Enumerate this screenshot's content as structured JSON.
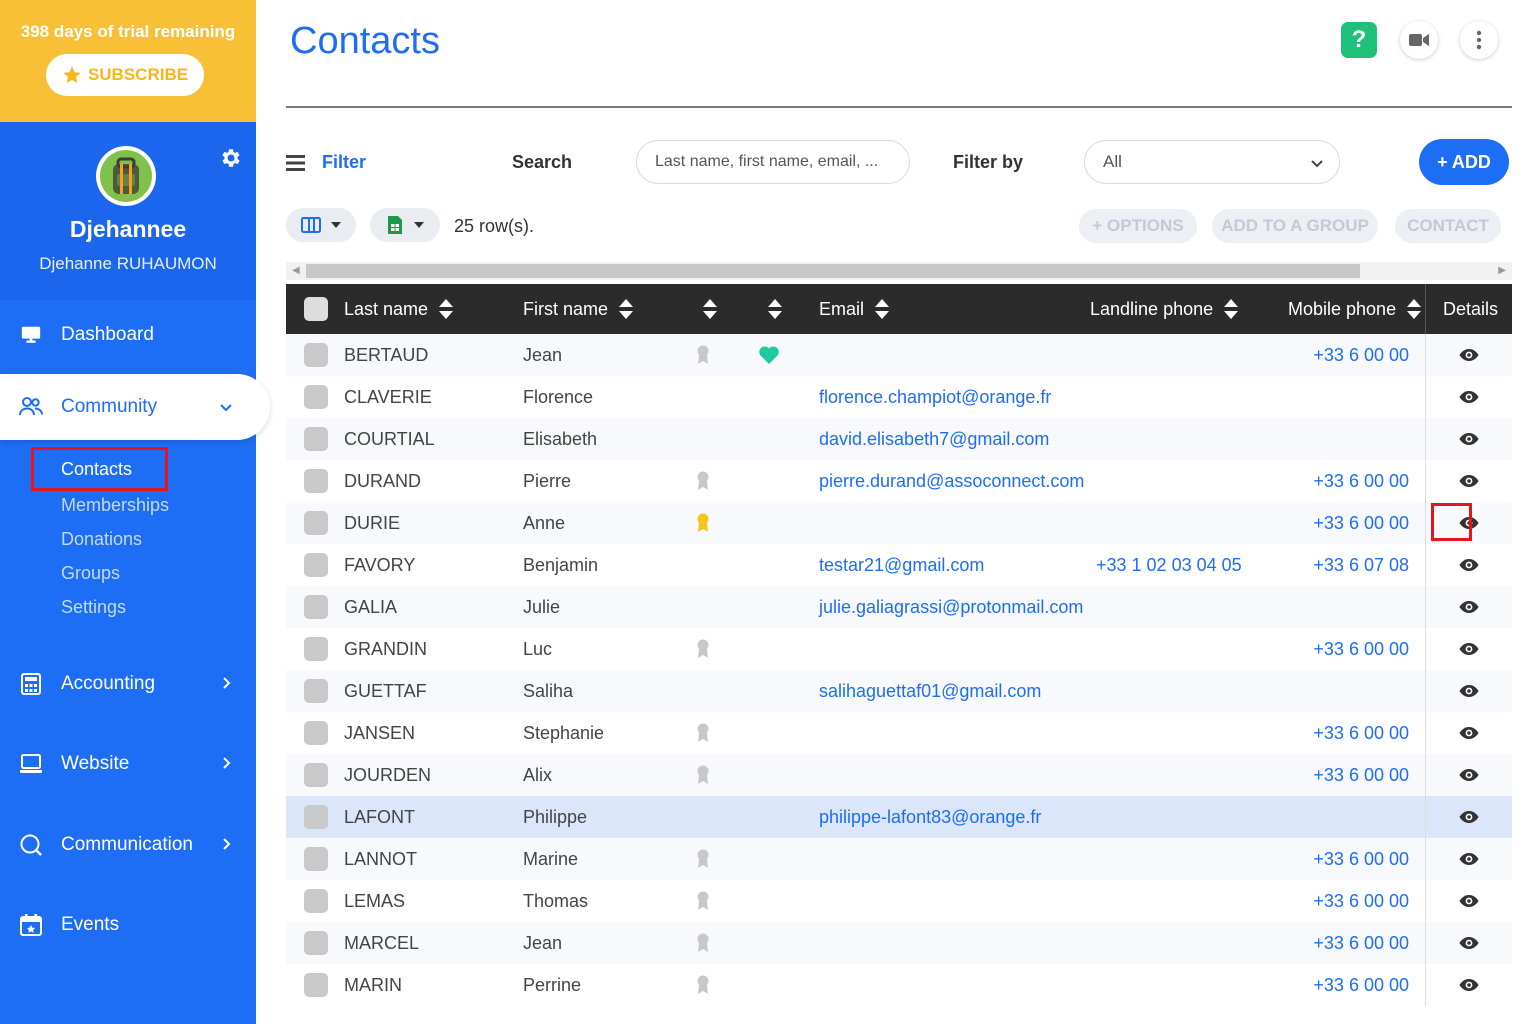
{
  "trial": {
    "text": "398 days of trial remaining",
    "subscribe_label": "SUBSCRIBE"
  },
  "profile": {
    "name": "Djehannee",
    "full_name": "Djehanne RUHAUMON"
  },
  "nav": {
    "dashboard": "Dashboard",
    "community": "Community",
    "community_sub": {
      "contacts": "Contacts",
      "memberships": "Memberships",
      "donations": "Donations",
      "groups": "Groups",
      "settings": "Settings"
    },
    "accounting": "Accounting",
    "website": "Website",
    "communication": "Communication",
    "events": "Events"
  },
  "header": {
    "title": "Contacts",
    "help_label": "?"
  },
  "toolbar": {
    "filter_label": "Filter",
    "search_label": "Search",
    "search_placeholder": "Last name, first name, email, ...",
    "filter_by_label": "Filter by",
    "filter_by_value": "All",
    "add_label": "+ ADD",
    "rows_count": "25 row(s).",
    "options_label": "+ OPTIONS",
    "add_to_group_label": "ADD TO A GROUP",
    "contact_label": "CONTACT"
  },
  "table": {
    "columns": {
      "last_name": "Last name",
      "first_name": "First name",
      "email": "Email",
      "landline": "Landline phone",
      "mobile": "Mobile phone",
      "details": "Details"
    },
    "rows": [
      {
        "last": "BERTAUD",
        "first": "Jean",
        "badge": "grey",
        "heart": true,
        "email": "",
        "landline": "",
        "mobile": "+33 6 00 00"
      },
      {
        "last": "CLAVERIE",
        "first": "Florence",
        "badge": "",
        "heart": false,
        "email": "florence.champiot@orange.fr",
        "landline": "",
        "mobile": ""
      },
      {
        "last": "COURTIAL",
        "first": "Elisabeth",
        "badge": "",
        "heart": false,
        "email": "david.elisabeth7@gmail.com",
        "landline": "",
        "mobile": ""
      },
      {
        "last": "DURAND",
        "first": "Pierre",
        "badge": "grey",
        "heart": false,
        "email": "pierre.durand@assoconnect.com",
        "landline": "",
        "mobile": "+33 6 00 00"
      },
      {
        "last": "DURIE",
        "first": "Anne",
        "badge": "gold",
        "heart": false,
        "email": "",
        "landline": "",
        "mobile": "+33 6 00 00"
      },
      {
        "last": "FAVORY",
        "first": "Benjamin",
        "badge": "",
        "heart": false,
        "email": "testar21@gmail.com",
        "landline": "+33 1 02 03 04 05",
        "mobile": "+33 6 07 08"
      },
      {
        "last": "GALIA",
        "first": "Julie",
        "badge": "",
        "heart": false,
        "email": "julie.galiagrassi@protonmail.com",
        "landline": "",
        "mobile": ""
      },
      {
        "last": "GRANDIN",
        "first": "Luc",
        "badge": "grey",
        "heart": false,
        "email": "",
        "landline": "",
        "mobile": "+33 6 00 00"
      },
      {
        "last": "GUETTAF",
        "first": "Saliha",
        "badge": "",
        "heart": false,
        "email": "salihaguettaf01@gmail.com",
        "landline": "",
        "mobile": ""
      },
      {
        "last": "JANSEN",
        "first": "Stephanie",
        "badge": "grey",
        "heart": false,
        "email": "",
        "landline": "",
        "mobile": "+33 6 00 00"
      },
      {
        "last": "JOURDEN",
        "first": "Alix",
        "badge": "grey",
        "heart": false,
        "email": "",
        "landline": "",
        "mobile": "+33 6 00 00"
      },
      {
        "last": "LAFONT",
        "first": "Philippe",
        "badge": "",
        "heart": false,
        "email": "philippe-lafont83@orange.fr",
        "landline": "",
        "mobile": ""
      },
      {
        "last": "LANNOT",
        "first": "Marine",
        "badge": "grey",
        "heart": false,
        "email": "",
        "landline": "",
        "mobile": "+33 6 00 00"
      },
      {
        "last": "LEMAS",
        "first": "Thomas",
        "badge": "grey",
        "heart": false,
        "email": "",
        "landline": "",
        "mobile": "+33 6 00 00"
      },
      {
        "last": "MARCEL",
        "first": "Jean",
        "badge": "grey",
        "heart": false,
        "email": "",
        "landline": "",
        "mobile": "+33 6 00 00"
      },
      {
        "last": "MARIN",
        "first": "Perrine",
        "badge": "grey",
        "heart": false,
        "email": "",
        "landline": "",
        "mobile": "+33 6 00 00"
      }
    ]
  },
  "colors": {
    "primary": "#1e6ef5",
    "trial": "#f8c037",
    "help": "#1fc07a",
    "highlight": "#e8141b",
    "heart": "#1fc9a0",
    "badge_gold": "#f5c518",
    "badge_grey": "#c8c8c8"
  },
  "icons": [
    "star-icon",
    "gear-icon",
    "dashboard-icon",
    "community-icon",
    "accounting-icon",
    "website-icon",
    "communication-icon",
    "events-icon",
    "video-icon",
    "more-icon",
    "menu-icon",
    "columns-icon",
    "export-icon",
    "sort-icon",
    "eye-icon",
    "heart-icon",
    "badge-icon"
  ]
}
